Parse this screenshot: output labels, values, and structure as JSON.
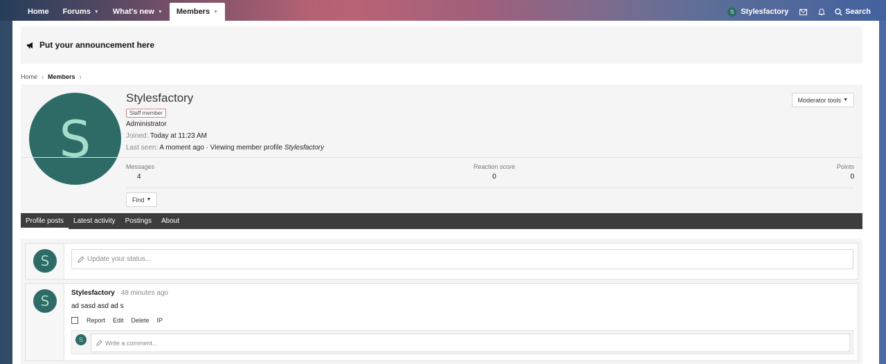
{
  "nav": {
    "tabs": [
      {
        "label": "Home",
        "has_menu": false
      },
      {
        "label": "Forums",
        "has_menu": true
      },
      {
        "label": "What's new",
        "has_menu": true
      },
      {
        "label": "Members",
        "has_menu": true,
        "active": true
      }
    ],
    "user": {
      "initial": "S",
      "name": "Stylesfactory"
    },
    "inbox_icon": "envelope-icon",
    "alerts_icon": "bell-icon",
    "search_label": "Search"
  },
  "notice": {
    "text": "Put your announcement here",
    "icon": "megaphone-icon"
  },
  "breadcrumb": {
    "home": "Home",
    "members": "Members"
  },
  "profile": {
    "initial": "S",
    "name": "Stylesfactory",
    "badge": "Staff member",
    "role": "Administrator",
    "joined_label": "Joined:",
    "joined_value": "Today at 11:23 AM",
    "seen_label": "Last seen:",
    "seen_value": "A moment ago · Viewing member profile",
    "seen_target": "Stylesfactory",
    "moderator_tools": "Moderator tools",
    "stats": {
      "messages_label": "Messages",
      "messages_value": "4",
      "reaction_label": "Reaction score",
      "reaction_value": "0",
      "points_label": "Points",
      "points_value": "0"
    },
    "find_label": "Find"
  },
  "profile_tabs": [
    "Profile posts",
    "Latest activity",
    "Postings",
    "About"
  ],
  "status_box": {
    "initial": "S",
    "placeholder": "Update your status..."
  },
  "post": {
    "initial": "S",
    "author": "Stylesfactory",
    "time": "· 48 minutes ago",
    "body": "ad sasd asd ad s",
    "actions": [
      "Report",
      "Edit",
      "Delete",
      "IP"
    ],
    "comment_initial": "S",
    "comment_placeholder": "Write a comment..."
  },
  "colors": {
    "avatar_bg": "#2e6b66",
    "avatar_fg": "#a5dccc",
    "tab_bar": "#3d3d3d"
  }
}
